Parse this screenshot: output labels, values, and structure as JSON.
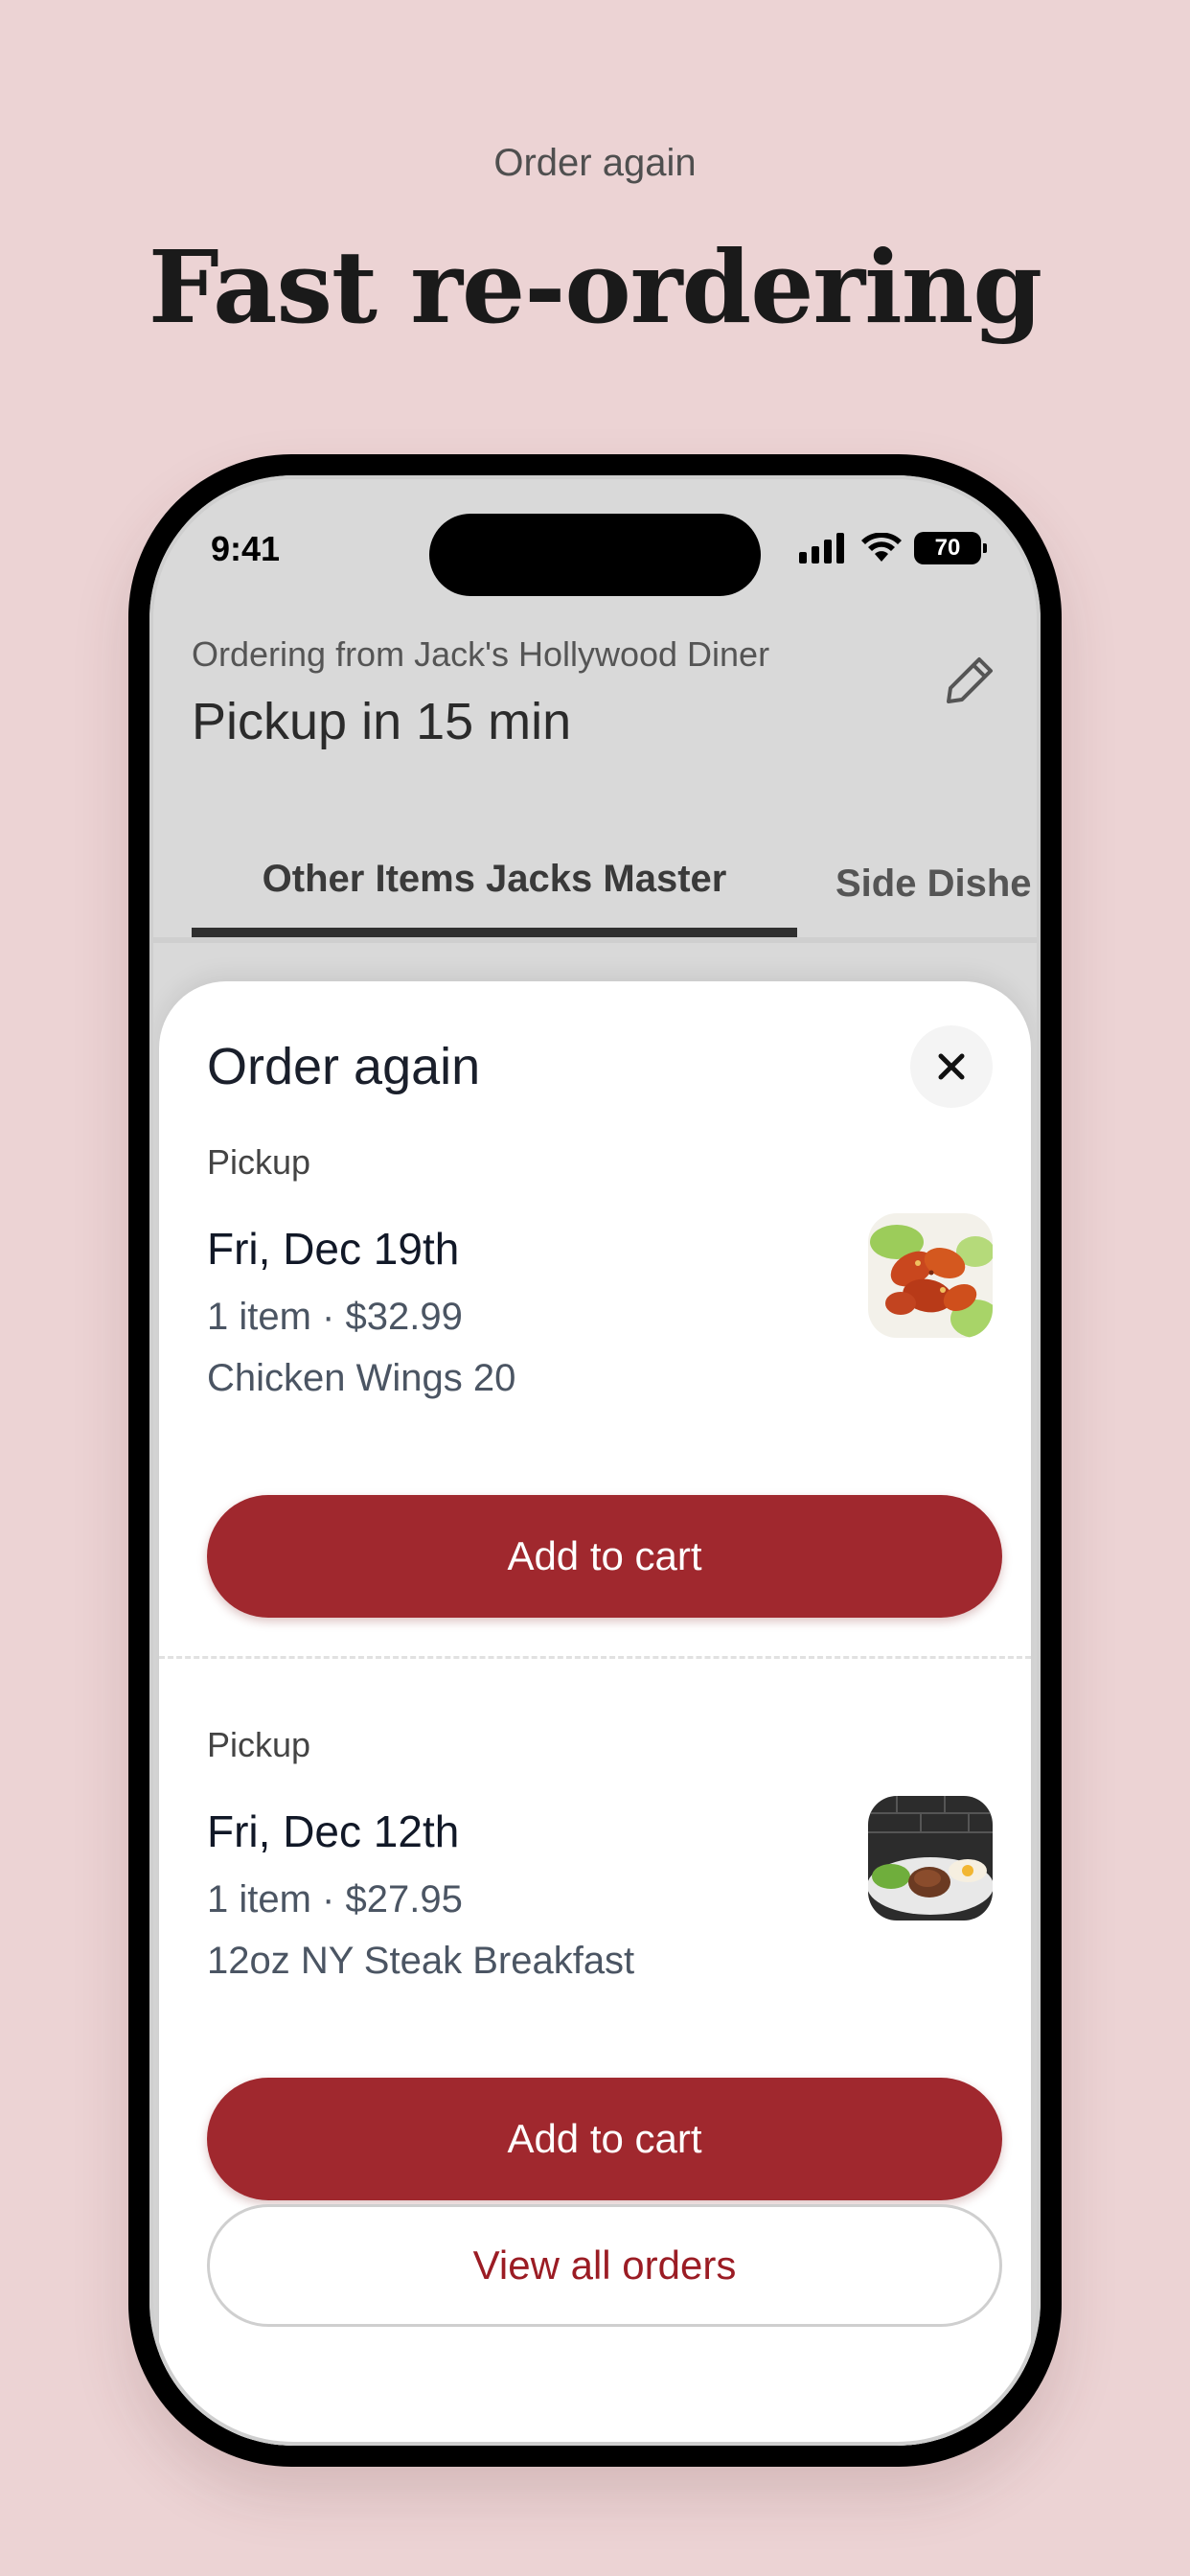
{
  "marketing": {
    "eyebrow": "Order again",
    "headline": "Fast re-ordering"
  },
  "status_bar": {
    "time": "9:41",
    "battery": "70",
    "icons": [
      "signal-icon",
      "wifi-icon",
      "battery-icon"
    ]
  },
  "header": {
    "ordering_from": "Ordering from Jack's Hollywood Diner",
    "pickup_time": "Pickup in 15 min",
    "edit_icon": "pencil-icon"
  },
  "tabs": [
    {
      "label": "Other Items Jacks Master",
      "active": true
    },
    {
      "label": "Side Dishe",
      "active": false
    }
  ],
  "sheet": {
    "title": "Order again",
    "close_icon": "close-icon",
    "orders": [
      {
        "type": "Pickup",
        "date": "Fri, Dec 19th",
        "summary": "1 item · $32.99",
        "item": "Chicken Wings 20",
        "thumb": "chicken-wings-photo",
        "button": "Add to cart"
      },
      {
        "type": "Pickup",
        "date": "Fri, Dec 12th",
        "summary": "1 item · $27.95",
        "item": "12oz NY Steak Breakfast",
        "thumb": "steak-breakfast-photo",
        "button": "Add to cart"
      }
    ],
    "view_all": "View all orders"
  },
  "colors": {
    "background": "#ecd3d4",
    "primary": "#a0282e",
    "link": "#9b1c24"
  }
}
